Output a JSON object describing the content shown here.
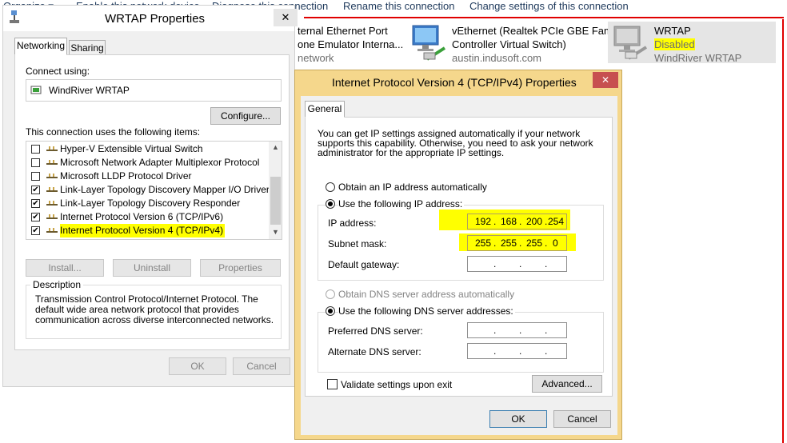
{
  "toolbar": {
    "organize": "Organize ▾",
    "enable_device": "Enable this network device",
    "diagnose": "Diagnose this connection",
    "rename": "Rename this connection",
    "change_settings": "Change settings of this connection"
  },
  "connections": [
    {
      "title": "ternal Ethernet Port",
      "sub": "one Emulator Interna...",
      "status": "network"
    },
    {
      "title": "vEthernet (Realtek PCIe GBE Family",
      "sub": "Controller Virtual Switch)",
      "status": "austin.indusoft.com"
    },
    {
      "title": "WRTAP",
      "sub": "Disabled",
      "status": "WindRiver WRTAP"
    }
  ],
  "wrtap_dialog": {
    "title": "WRTAP Properties",
    "close": "✕",
    "tabs": [
      "Networking",
      "Sharing"
    ],
    "connect_using_label": "Connect using:",
    "adapter_name": "WindRiver WRTAP",
    "configure_button": "Configure...",
    "items_label": "This connection uses the following items:",
    "items": [
      {
        "label": "Hyper-V Extensible Virtual Switch",
        "checked": false
      },
      {
        "label": "Microsoft Network Adapter Multiplexor Protocol",
        "checked": false
      },
      {
        "label": "Microsoft LLDP Protocol Driver",
        "checked": false
      },
      {
        "label": "Link-Layer Topology Discovery Mapper I/O Driver",
        "checked": true
      },
      {
        "label": "Link-Layer Topology Discovery Responder",
        "checked": true
      },
      {
        "label": "Internet Protocol Version 6 (TCP/IPv6)",
        "checked": true
      },
      {
        "label": "Internet Protocol Version 4 (TCP/IPv4)",
        "checked": true
      }
    ],
    "install_button": "Install...",
    "uninstall_button": "Uninstall",
    "properties_button": "Properties",
    "description_label": "Description",
    "description_text": "Transmission Control Protocol/Internet Protocol. The default wide area network protocol that provides communication across diverse interconnected networks.",
    "ok_button": "OK",
    "cancel_button": "Cancel"
  },
  "ipv4_dialog": {
    "title": "Internet Protocol Version 4 (TCP/IPv4) Properties",
    "close": "✕",
    "tab": "General",
    "intro": "You can get IP settings assigned automatically if your network supports this capability. Otherwise, you need to ask your network administrator for the appropriate IP settings.",
    "obtain_ip_auto": "Obtain an IP address automatically",
    "use_following_ip": "Use the following IP address:",
    "ip_address_label": "IP address:",
    "ip_address": [
      "192",
      "168",
      "200",
      "254"
    ],
    "subnet_label": "Subnet mask:",
    "subnet": [
      "255",
      "255",
      "255",
      "0"
    ],
    "gateway_label": "Default gateway:",
    "gateway": [
      "",
      "",
      "",
      ""
    ],
    "obtain_dns_auto": "Obtain DNS server address automatically",
    "use_following_dns": "Use the following DNS server addresses:",
    "preferred_dns_label": "Preferred DNS server:",
    "alternate_dns_label": "Alternate DNS server:",
    "validate_label": "Validate settings upon exit",
    "advanced_button": "Advanced...",
    "ok_button": "OK",
    "cancel_button": "Cancel"
  },
  "colors": {
    "highlight": "#ffff00",
    "annotation_red": "#e00000",
    "dialog_frame": "#f5d78c"
  }
}
